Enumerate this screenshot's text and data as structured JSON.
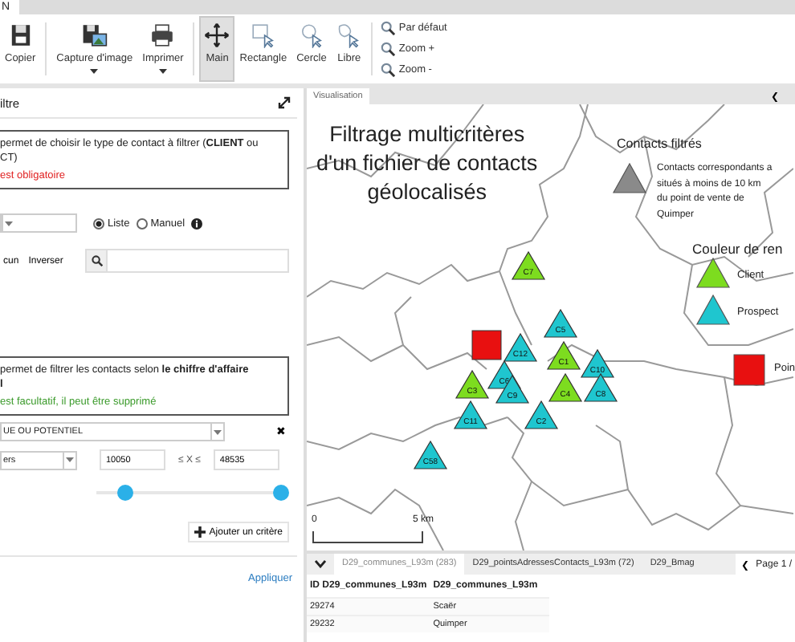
{
  "top_tab": {
    "label": "N"
  },
  "toolbar": {
    "buttons": [
      {
        "label": "Copier",
        "selected": false,
        "has_menu": false
      },
      {
        "label": "Capture d'image",
        "selected": false,
        "has_menu": true
      },
      {
        "label": "Imprimer",
        "selected": false,
        "has_menu": true
      },
      {
        "label": "Main",
        "selected": true,
        "has_menu": false
      },
      {
        "label": "Rectangle",
        "selected": false,
        "has_menu": false
      },
      {
        "label": "Cercle",
        "selected": false,
        "has_menu": false
      },
      {
        "label": "Libre",
        "selected": false,
        "has_menu": false
      }
    ],
    "zoom_items": [
      "Par défaut",
      "Zoom +",
      "Zoom -"
    ]
  },
  "filter_panel": {
    "title": "iltre",
    "criterion_1": {
      "description": [
        "permet de choisir le type de contact à filtrer (**CLIENT** ou",
        "CT)"
      ],
      "note": "est obligatoire",
      "required": true,
      "mode_options": [
        {
          "label": "Liste",
          "selected": true
        },
        {
          "label": "Manuel",
          "selected": false
        }
      ],
      "buttons": [
        "cun",
        "Inverser"
      ]
    },
    "criterion_2": {
      "description": [
        "permet de filtrer les contacts selon **le chiffre d'affaire**",
        "**l**"
      ],
      "note": "est facultatif, il peut être supprimé",
      "required": false,
      "field": "UE OU POTENTIEL",
      "remove": "✖",
      "operator": "ers",
      "min": "10050",
      "between": "≤ X ≤",
      "max": "48535",
      "thumbs": [
        {
          "level": 0.16
        },
        {
          "level": 1
        }
      ]
    },
    "add_button": "Ajouter un critère",
    "apply_link": "Appliquer"
  },
  "map_panel": {
    "tab": "Visualisation",
    "nav": "❮",
    "title_lines": [
      "Filtrage multicritères",
      "d'un fichier de contacts",
      "géolocalisés"
    ],
    "legend": {
      "heading": "Contacts filtrés",
      "filtered_lines": [
        "Contacts correspondants a",
        "situés à moins de 10 km",
        "du point de vente de",
        "Quimper"
      ],
      "color_heading": "Couleur de ren",
      "items": [
        {
          "label": "Client",
          "kind": "triangle",
          "color": "#7ddc1f"
        },
        {
          "label": "Prospect",
          "kind": "triangle",
          "color": "#1fc6cf"
        },
        {
          "label": "Poin",
          "kind": "square",
          "color": "#e81010"
        }
      ]
    },
    "markers": [
      {
        "label": "C7",
        "kind": "triangle",
        "color": "#7ddc1f"
      },
      {
        "kind": "square",
        "color": "#e81010"
      },
      {
        "label": "C5",
        "kind": "triangle",
        "color": "#1fc6cf"
      },
      {
        "label": "C12",
        "kind": "triangle",
        "color": "#1fc6cf"
      },
      {
        "label": "C1",
        "kind": "triangle",
        "color": "#7ddc1f"
      },
      {
        "label": "C10",
        "kind": "triangle",
        "color": "#1fc6cf"
      },
      {
        "label": "C3",
        "kind": "triangle",
        "color": "#7ddc1f"
      },
      {
        "label": "C6",
        "kind": "triangle",
        "color": "#1fc6cf"
      },
      {
        "label": "C9",
        "kind": "triangle",
        "color": "#1fc6cf"
      },
      {
        "label": "C2",
        "kind": "triangle",
        "color": "#1fc6cf"
      },
      {
        "label": "C4",
        "kind": "triangle",
        "color": "#7ddc1f"
      },
      {
        "label": "C8",
        "kind": "triangle",
        "color": "#1fc6cf"
      },
      {
        "label": "C11",
        "kind": "triangle",
        "color": "#1fc6cf"
      },
      {
        "label": "C58",
        "kind": "triangle",
        "color": "#1fc6cf"
      }
    ],
    "scale": {
      "start": "0",
      "end": "5 km"
    }
  },
  "layer_tabs": [
    {
      "label": "D29_communes_L93m (283)",
      "selected": true
    },
    {
      "label": "D29_pointsAdressesContacts_L93m (72)",
      "selected": false
    },
    {
      "label": "D29_Bmag",
      "selected": false
    }
  ],
  "pager": {
    "prev": "❮",
    "label": "Page 1 /"
  },
  "table": {
    "columns": [
      "ID D29_communes_L93m",
      "D29_communes_L93m"
    ],
    "rows": [
      [
        "29274",
        "Scaër"
      ],
      [
        "29232",
        "Quimper"
      ]
    ]
  }
}
